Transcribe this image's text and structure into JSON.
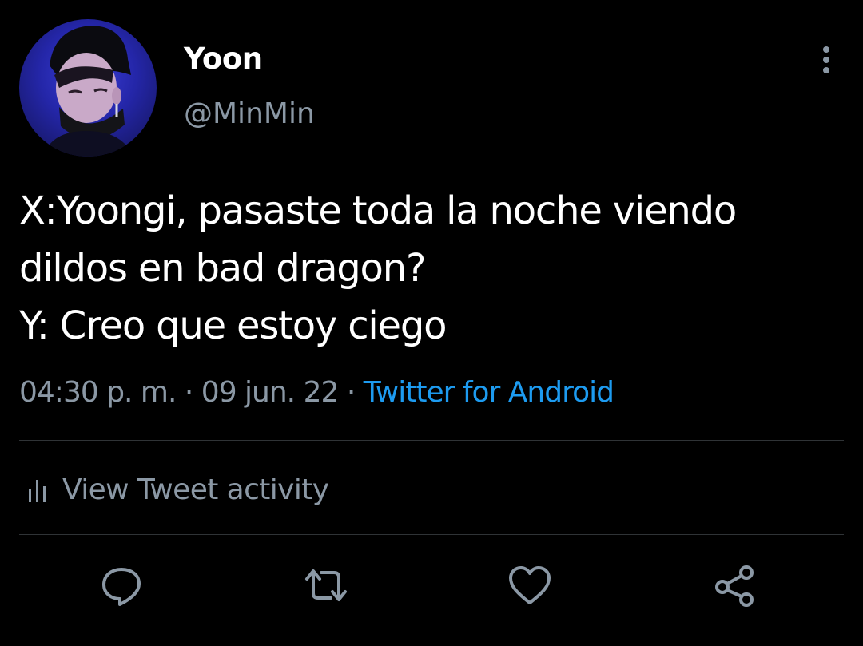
{
  "author": {
    "display_name": "Yoon",
    "handle": "@MinMin"
  },
  "tweet": {
    "lines": [
      "X:Yoongi, pasaste toda la noche viendo",
      "dildos en bad dragon?",
      "Y: Creo que estoy ciego"
    ],
    "time": "04:30 p. m.",
    "separator": " · ",
    "date": "09 jun. 22",
    "source": "Twitter for Android"
  },
  "activity": {
    "label": "View Tweet activity",
    "icon": "bar-chart-icon"
  },
  "actions": [
    {
      "name": "reply",
      "icon": "speech-bubble-icon"
    },
    {
      "name": "retweet",
      "icon": "retweet-arrows-icon"
    },
    {
      "name": "like",
      "icon": "heart-outline-icon"
    },
    {
      "name": "share",
      "icon": "share-nodes-icon"
    }
  ],
  "colors": {
    "background": "#000000",
    "primary_text": "#ffffff",
    "secondary_text": "#8b98a5",
    "link": "#1d9bf0",
    "divider": "#2f3336"
  }
}
